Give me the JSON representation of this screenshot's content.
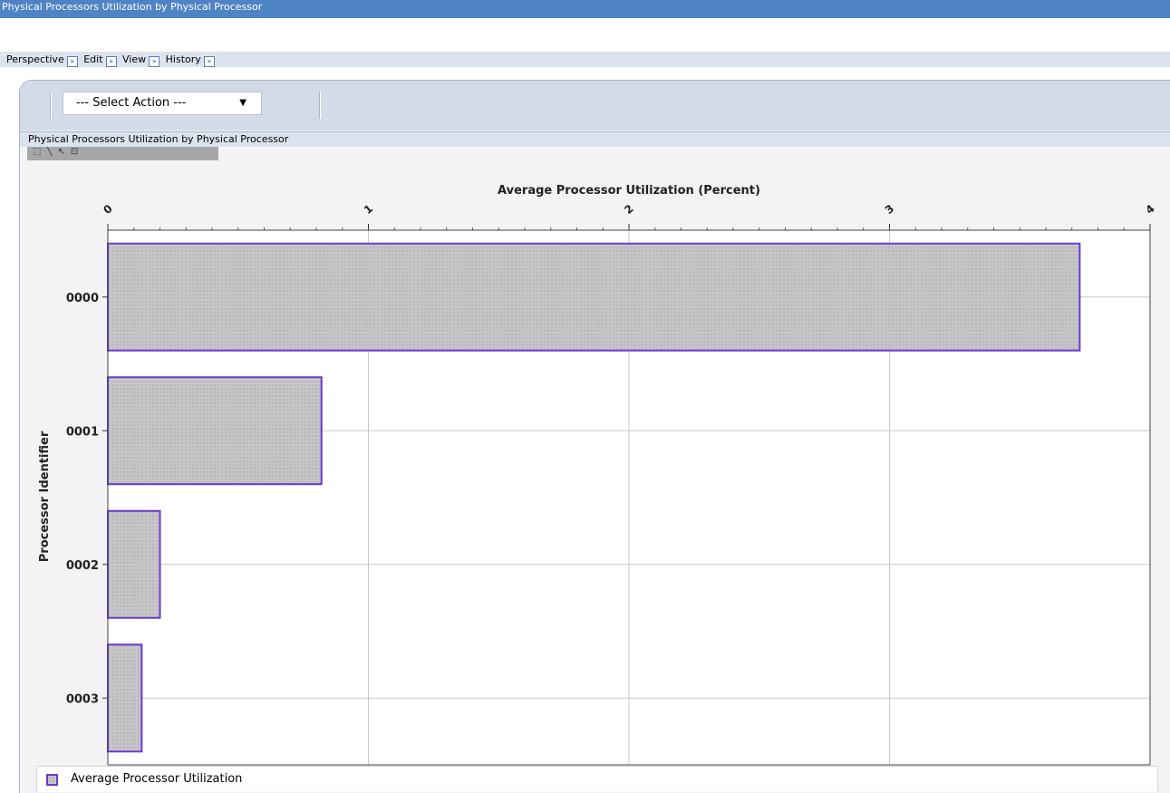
{
  "window": {
    "title": "Physical Processors Utilization by Physical Processor"
  },
  "menu": {
    "items": [
      "Perspective",
      "Edit",
      "View",
      "History"
    ],
    "arrow_glyph": "»"
  },
  "toolbar": {
    "select_action": "--- Select Action ---"
  },
  "portlet": {
    "title": "Physical Processors Utilization by Physical Processor"
  },
  "chart_toolbar": {
    "icons": [
      "pointer-icon",
      "line-icon",
      "zoom-icon",
      "export-icon"
    ]
  },
  "chart_data": {
    "type": "bar",
    "orientation": "horizontal",
    "title": "",
    "xlabel": "Average Processor Utilization (Percent)",
    "ylabel": "Processor Identifier",
    "categories": [
      "0000",
      "0001",
      "0002",
      "0003"
    ],
    "series": [
      {
        "name": "Average Processor Utilization",
        "values": [
          3.73,
          0.82,
          0.2,
          0.13
        ]
      }
    ],
    "xlim": [
      0,
      4
    ],
    "x_ticks": [
      "0",
      "1",
      "2",
      "3",
      "4"
    ],
    "grid": true,
    "legend_position": "bottom",
    "colors": {
      "bar_fill": "#c7c6c6",
      "bar_border": "#6a3ad0",
      "bar_dots": "#7a79a8",
      "grid": "#c8c8c8"
    }
  }
}
